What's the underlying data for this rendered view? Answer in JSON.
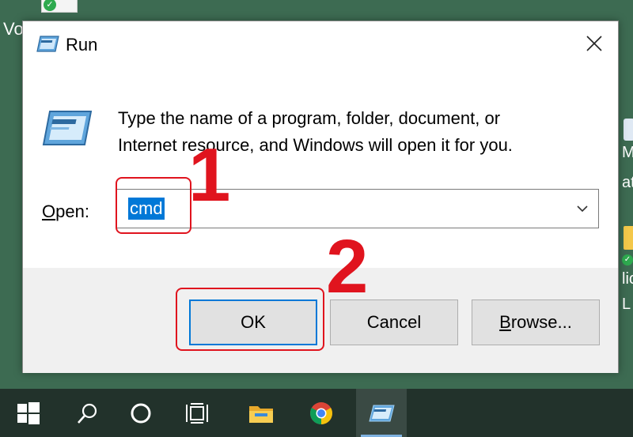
{
  "desktop": {
    "left_text": "Vo",
    "right_texts": [
      "M",
      "ati",
      "lic",
      "L"
    ]
  },
  "dialog": {
    "title": "Run",
    "message_line1": "Type the name of a program, folder, document, or",
    "message_line2": "Internet resource, and Windows will open it for you.",
    "open_label_underlined": "O",
    "open_label_rest": "pen:",
    "open_value": "cmd",
    "buttons": {
      "ok": "OK",
      "cancel": "Cancel",
      "browse_underlined": "B",
      "browse_rest": "rowse..."
    }
  },
  "annotations": {
    "step1": "1",
    "step2": "2"
  },
  "taskbar": {
    "items": [
      "windows-start",
      "search",
      "cortana",
      "task-view",
      "file-explorer",
      "chrome",
      "run"
    ]
  },
  "colors": {
    "accent": "#0078d7",
    "annotation": "#e0141e",
    "taskbar": "#22322b"
  }
}
